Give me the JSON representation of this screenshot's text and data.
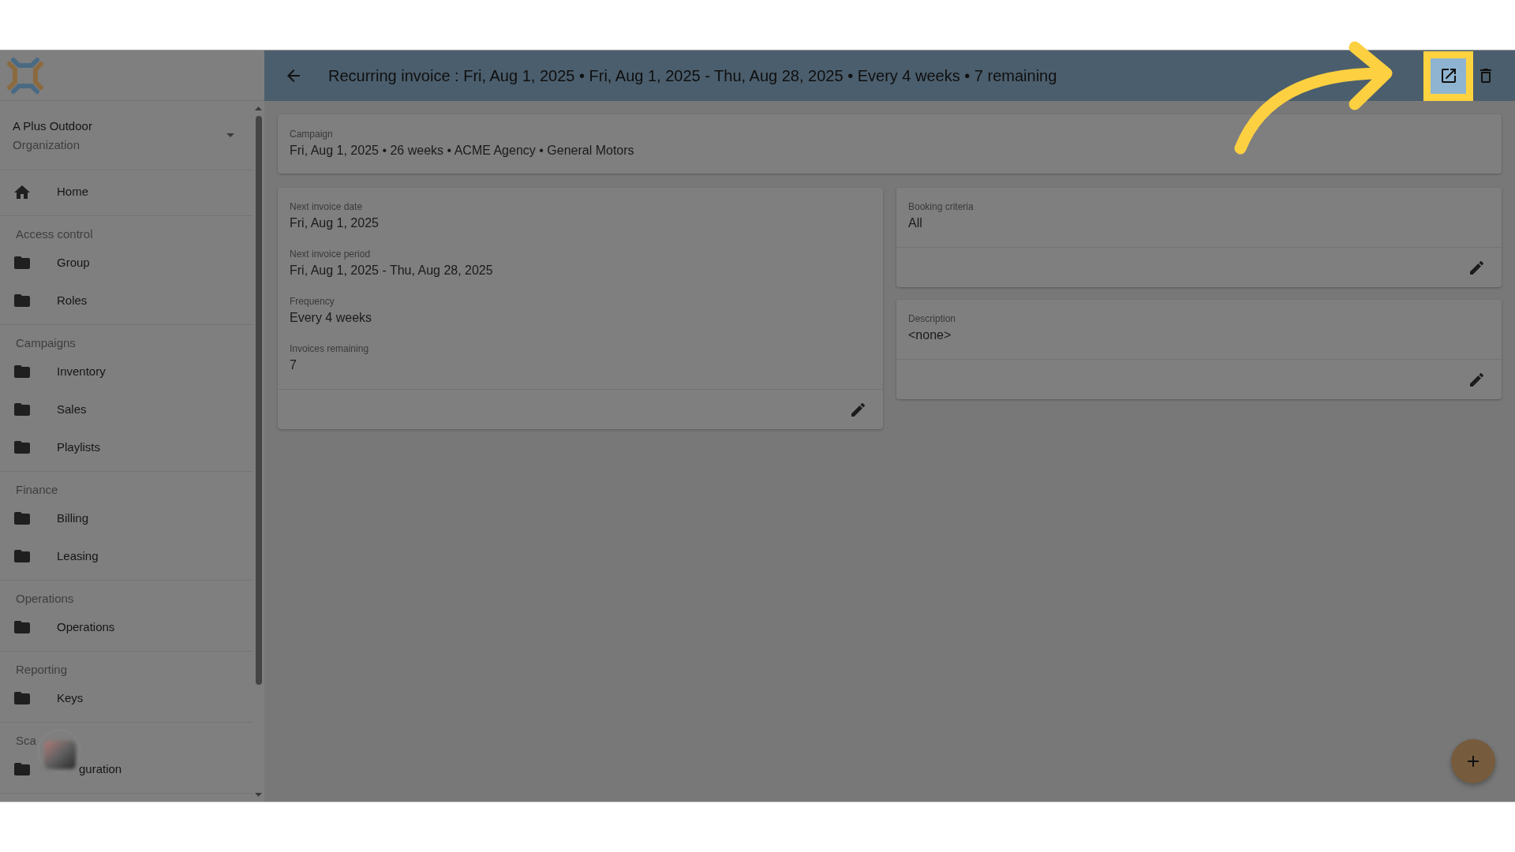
{
  "sidebar": {
    "organization": {
      "name": "A Plus Outdoor",
      "subtitle": "Organization"
    },
    "sections": [
      {
        "items": [
          {
            "label": "Home",
            "kind": "home",
            "selected": false
          }
        ]
      },
      {
        "title": "Access control",
        "items": [
          {
            "label": "Group",
            "kind": "folder",
            "selected": false
          },
          {
            "label": "Roles",
            "kind": "folder",
            "selected": false
          }
        ]
      },
      {
        "title": "Campaigns",
        "items": [
          {
            "label": "Inventory",
            "kind": "folder",
            "selected": false
          },
          {
            "label": "Sales",
            "kind": "folder",
            "selected": false
          },
          {
            "label": "Playlists",
            "kind": "folder",
            "selected": false
          }
        ]
      },
      {
        "title": "Finance",
        "items": [
          {
            "label": "Billing",
            "kind": "folder",
            "selected": false
          },
          {
            "label": "Leasing",
            "kind": "folder",
            "selected": false
          }
        ]
      },
      {
        "title": "Operations",
        "items": [
          {
            "label": "Operations",
            "kind": "folder",
            "selected": false
          }
        ]
      },
      {
        "title": "Reporting",
        "items": [
          {
            "label": "Keys",
            "kind": "folder",
            "selected": false
          }
        ]
      },
      {
        "title": "Sca",
        "items": [
          {
            "label": "guration",
            "kind": "folder",
            "selected": false,
            "obscured": true
          }
        ]
      }
    ]
  },
  "header": {
    "title": "Recurring invoice : Fri, Aug 1, 2025 • Fri, Aug 1, 2025 - Thu, Aug 28, 2025 • Every 4 weeks • 7 remaining",
    "actions": [
      {
        "kind": "open",
        "highlighted": true
      },
      {
        "kind": "delete",
        "highlighted": false
      }
    ]
  },
  "campaign": {
    "label": "Campaign",
    "value": "Fri, Aug 1, 2025 • 26 weeks • ACME Agency • General Motors"
  },
  "columns": [
    {
      "cards": [
        {
          "fields": [
            {
              "label": "Next invoice date",
              "value": "Fri, Aug 1, 2025"
            },
            {
              "label": "Next invoice period",
              "value": "Fri, Aug 1, 2025 - Thu, Aug 28, 2025"
            },
            {
              "label": "Frequency",
              "value": "Every 4 weeks"
            },
            {
              "label": "Invoices remaining",
              "value": "7"
            }
          ]
        }
      ]
    },
    {
      "cards": [
        {
          "fields": [
            {
              "label": "Booking criteria",
              "value": "All"
            }
          ]
        },
        {
          "fields": [
            {
              "label": "Description",
              "value": "<none>"
            }
          ]
        }
      ]
    }
  ]
}
